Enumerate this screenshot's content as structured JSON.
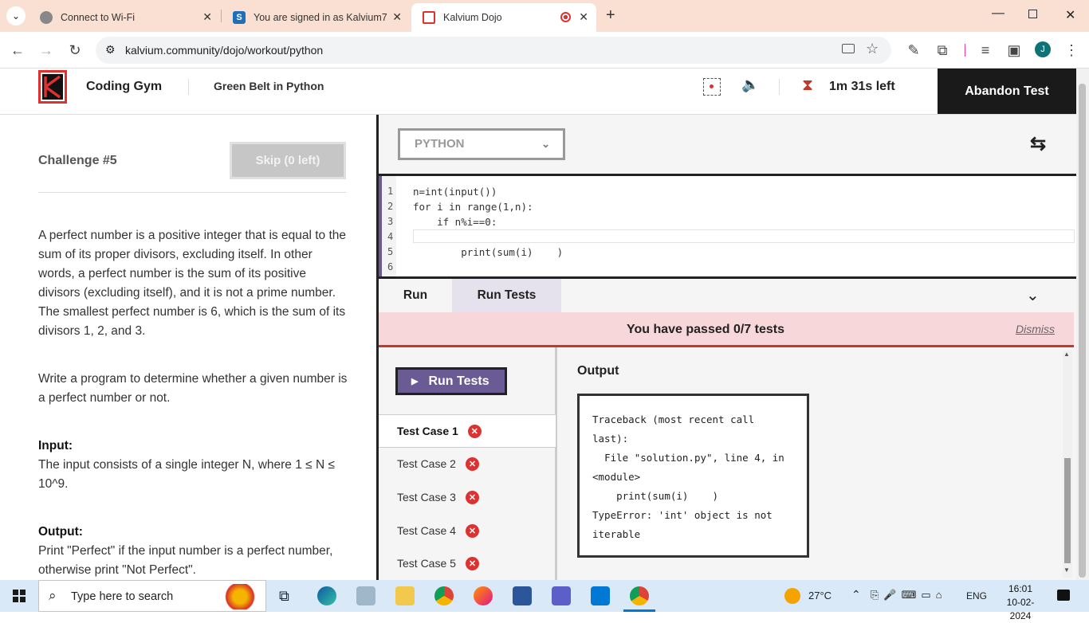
{
  "browser": {
    "tabs": [
      {
        "title": "Connect to Wi-Fi"
      },
      {
        "title": "You are signed in as Kalvium7"
      },
      {
        "title": "Kalvium Dojo"
      }
    ],
    "url": "kalvium.community/dojo/workout/python",
    "profile_initial": "J"
  },
  "header": {
    "brand": "Coding Gym",
    "belt": "Green Belt in Python",
    "timer": "1m 31s left",
    "abandon_label": "Abandon Test"
  },
  "challenge": {
    "title": "Challenge #5",
    "skip_label": "Skip (0 left)",
    "description": "A perfect number is a positive integer that is equal to the sum of its proper divisors, excluding itself. In other words, a perfect number is the sum of its positive divisors (excluding itself), and it is not a prime number. The smallest perfect number is 6, which is the sum of its divisors 1, 2, and 3.",
    "task": "Write a program to determine whether a given number is a perfect number or not.",
    "input_heading": "Input:",
    "input_text": "The input consists of a single integer N, where 1 ≤ N ≤ 10^9.",
    "output_heading": "Output:",
    "output_text": "Print \"Perfect\" if the input number is a perfect number, otherwise print \"Not Perfect\"."
  },
  "editor": {
    "language": "PYTHON",
    "line_numbers": [
      "1",
      "2",
      "3",
      "4",
      "5",
      "6"
    ],
    "code_lines": [
      "n=int(input())",
      "for i in range(1,n):",
      "    if n%i==0:",
      "",
      "        print(sum(i)    )",
      ""
    ]
  },
  "run_tabs": {
    "run": "Run",
    "run_tests": "Run Tests"
  },
  "results": {
    "banner": "You have passed 0/7 tests",
    "dismiss": "Dismiss",
    "run_tests_button": "Run Tests",
    "test_cases": [
      "Test Case 1",
      "Test Case 2",
      "Test Case 3",
      "Test Case 4",
      "Test Case 5"
    ],
    "output_label": "Output",
    "output_text": "Traceback (most recent call last):\n  File \"solution.py\", line 4, in <module>\n    print(sum(i)    )\nTypeError: 'int' object is not iterable"
  },
  "taskbar": {
    "search_placeholder": "Type here to search",
    "weather": "27°C",
    "language": "ENG",
    "time": "16:01",
    "date": "10-02-2024"
  },
  "colors": {
    "accent": "#6b5b95",
    "fail": "#e03131",
    "banner_bg": "#f8d7da"
  }
}
